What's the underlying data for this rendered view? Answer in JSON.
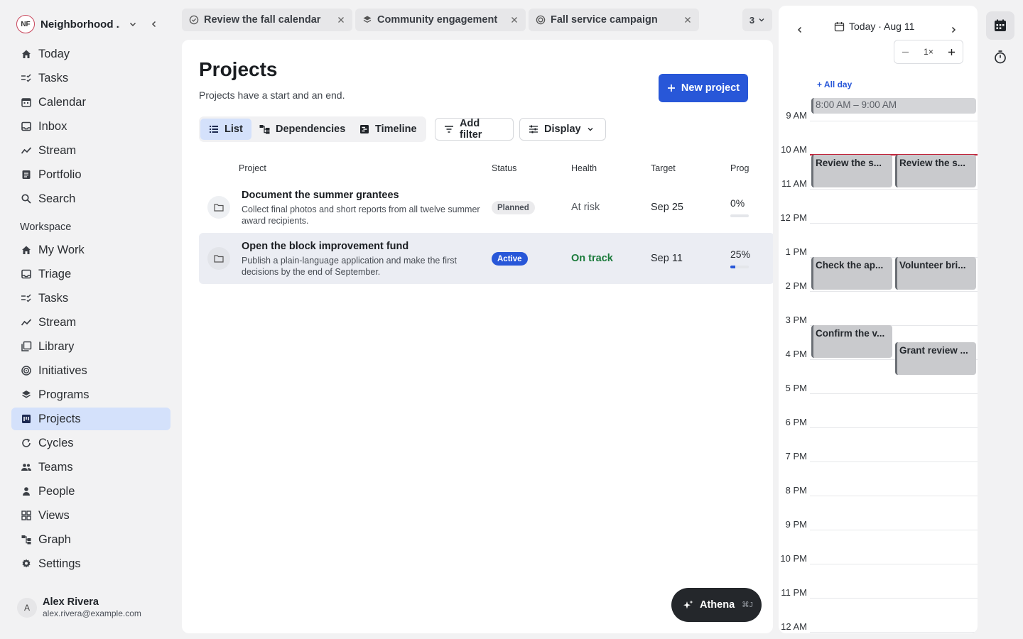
{
  "workspace": {
    "initials": "NF",
    "name": "Neighborhood ..."
  },
  "nav_primary": [
    {
      "label": "Today",
      "icon": "home-icon"
    },
    {
      "label": "Tasks",
      "icon": "tasks-icon"
    },
    {
      "label": "Calendar",
      "icon": "calendar-icon"
    },
    {
      "label": "Inbox",
      "icon": "inbox-icon"
    },
    {
      "label": "Stream",
      "icon": "stream-icon"
    },
    {
      "label": "Portfolio",
      "icon": "portfolio-icon"
    },
    {
      "label": "Search",
      "icon": "search-icon"
    }
  ],
  "workspace_section": "Workspace",
  "nav_workspace": [
    {
      "label": "My Work",
      "icon": "home-icon"
    },
    {
      "label": "Triage",
      "icon": "inbox-icon"
    },
    {
      "label": "Tasks",
      "icon": "tasks-icon"
    },
    {
      "label": "Stream",
      "icon": "stream-icon"
    },
    {
      "label": "Library",
      "icon": "library-icon"
    },
    {
      "label": "Initiatives",
      "icon": "initiatives-icon"
    },
    {
      "label": "Programs",
      "icon": "programs-icon"
    },
    {
      "label": "Projects",
      "icon": "projects-icon",
      "active": true
    },
    {
      "label": "Cycles",
      "icon": "cycles-icon"
    },
    {
      "label": "Teams",
      "icon": "teams-icon"
    },
    {
      "label": "People",
      "icon": "person-icon"
    },
    {
      "label": "Views",
      "icon": "views-icon"
    },
    {
      "label": "Graph",
      "icon": "graph-icon"
    },
    {
      "label": "Settings",
      "icon": "gear-icon"
    }
  ],
  "user": {
    "initial": "A",
    "name": "Alex Rivera",
    "email": "alex.rivera@example.com"
  },
  "tabs": [
    {
      "label": "Review the fall calendar",
      "icon": "check-circle-icon"
    },
    {
      "label": "Community engagement",
      "icon": "layers-icon"
    },
    {
      "label": "Fall service campaign",
      "icon": "target-icon"
    }
  ],
  "tab_overflow_count": "3",
  "main": {
    "title": "Projects",
    "subtitle": "Projects have a start and an end.",
    "new_project_label": "New project",
    "views": [
      "List",
      "Dependencies",
      "Timeline"
    ],
    "add_filter_label": "Add filter",
    "display_label": "Display",
    "columns": {
      "project": "Project",
      "status": "Status",
      "health": "Health",
      "target": "Target",
      "progress": "Prog"
    },
    "rows": [
      {
        "title": "Document the summer grantees",
        "description": "Collect final photos and short reports from all twelve summer award recipients.",
        "status": "Planned",
        "health": "At risk",
        "target": "Sep 25",
        "progress_text": "0%",
        "progress": 0
      },
      {
        "title": "Open the block improvement fund",
        "description": "Publish a plain-language application and make the first decisions by the end of September.",
        "status": "Active",
        "health": "On track",
        "target": "Sep 11",
        "progress_text": "25%",
        "progress": 0.25
      }
    ]
  },
  "assistant": {
    "label": "Athena",
    "shortcut": "⌘J"
  },
  "calendar": {
    "date_label": "Today · Aug 11",
    "zoom_label": "1×",
    "all_day_label": "+ All day",
    "hours": [
      "9 AM",
      "10 AM",
      "11 AM",
      "12 PM",
      "1 PM",
      "2 PM",
      "3 PM",
      "4 PM",
      "5 PM",
      "6 PM",
      "7 PM",
      "8 PM",
      "9 PM",
      "10 PM",
      "11 PM",
      "12 AM"
    ],
    "events": [
      {
        "title": "8:00 AM – 9:00 AM"
      },
      {
        "title": "Review the s..."
      },
      {
        "title": "Review the s..."
      },
      {
        "title": "Check the ap..."
      },
      {
        "title": "Volunteer bri..."
      },
      {
        "title": "Confirm the v..."
      },
      {
        "title": "Grant review ..."
      }
    ]
  },
  "colors": {
    "accent": "#2857d8",
    "active_nav": "#d4e1fb",
    "on_track": "#1a7a3a",
    "now_line": "#c0243a"
  }
}
